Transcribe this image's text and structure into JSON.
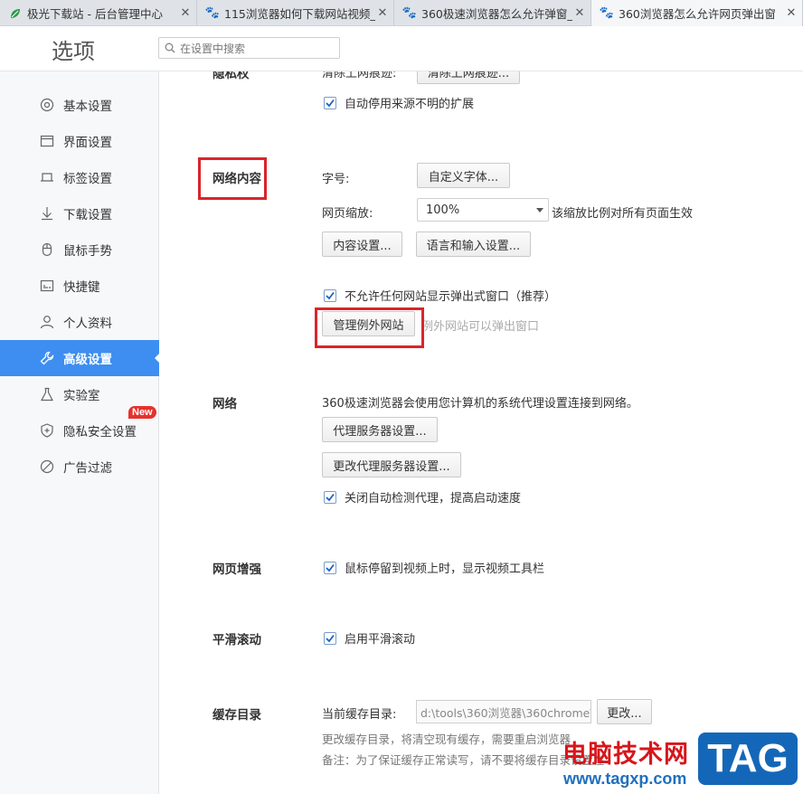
{
  "tabs": [
    {
      "title": "极光下载站 - 后台管理中心",
      "icon": "leaf-icon"
    },
    {
      "title": "115浏览器如何下载网站视频_",
      "icon": "paw-icon"
    },
    {
      "title": "360极速浏览器怎么允许弹窗_",
      "icon": "paw-icon"
    },
    {
      "title": "360浏览器怎么允许网页弹出窗",
      "icon": "paw-icon"
    }
  ],
  "header": {
    "title": "选项",
    "search_placeholder": "在设置中搜索"
  },
  "sidebar": {
    "items": [
      {
        "label": "基本设置",
        "icon": "gear-icon"
      },
      {
        "label": "界面设置",
        "icon": "window-icon"
      },
      {
        "label": "标签设置",
        "icon": "tab-icon"
      },
      {
        "label": "下载设置",
        "icon": "download-icon"
      },
      {
        "label": "鼠标手势",
        "icon": "mouse-icon"
      },
      {
        "label": "快捷键",
        "icon": "keyboard-icon"
      },
      {
        "label": "个人资料",
        "icon": "user-icon"
      },
      {
        "label": "高级设置",
        "icon": "wrench-icon",
        "active": true
      },
      {
        "label": "实验室",
        "icon": "flask-icon"
      },
      {
        "label": "隐私安全设置",
        "icon": "shield-icon",
        "badge": "New"
      },
      {
        "label": "广告过滤",
        "icon": "block-icon"
      }
    ]
  },
  "main": {
    "privacy": {
      "label": "隐私权",
      "clear_label": "清除上网痕迹:",
      "clear_button": "清除上网痕迹...",
      "auto_disable_ext": "自动停用来源不明的扩展"
    },
    "web_content": {
      "label": "网络内容",
      "font_label": "字号:",
      "font_button": "自定义字体...",
      "zoom_label": "网页缩放:",
      "zoom_value": "100%",
      "zoom_note": "该缩放比例对所有页面生效",
      "content_button": "内容设置...",
      "language_button": "语言和输入设置...",
      "no_popup": "不允许任何网站显示弹出式窗口（推荐）",
      "manage_exceptions_button": "管理例外网站",
      "exceptions_note": "例外网站可以弹出窗口"
    },
    "network": {
      "label": "网络",
      "description": "360极速浏览器会使用您计算机的系统代理设置连接到网络。",
      "proxy_button": "代理服务器设置...",
      "change_proxy_button": "更改代理服务器设置...",
      "auto_detect": "关闭自动检测代理，提高启动速度"
    },
    "enhance": {
      "label": "网页增强",
      "video_toolbar": "鼠标停留到视频上时，显示视频工具栏"
    },
    "smooth": {
      "label": "平滑滚动",
      "enable": "启用平滑滚动"
    },
    "cache": {
      "label": "缓存目录",
      "current_label": "当前缓存目录:",
      "path": "d:\\tools\\360浏览器\\360chrome\\c",
      "change_button": "更改...",
      "note1": "更改缓存目录，将清空现有缓存，需要重启浏览器",
      "note2": "备注：为了保证缓存正常读写，请不要将缓存目录设置在"
    }
  },
  "watermark": {
    "cn": "电脑技术网",
    "url": "www.tagxp.com",
    "tag": "TAG"
  },
  "colors": {
    "accent": "#3d8ef0",
    "highlight_box": "#d9252a",
    "badge": "#e5322d"
  }
}
